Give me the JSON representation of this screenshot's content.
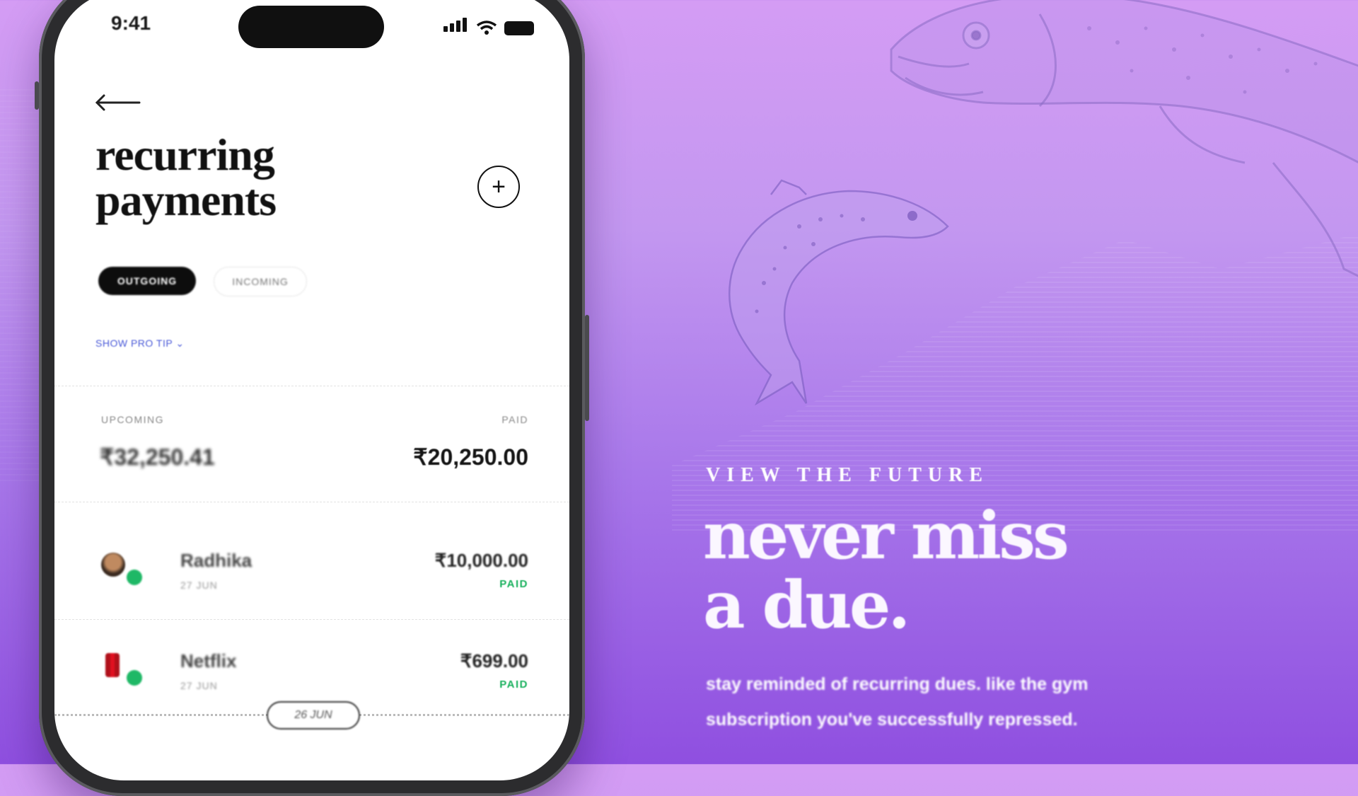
{
  "status_bar": {
    "time": "9:41"
  },
  "screen": {
    "title_line1": "recurring",
    "title_line2": "payments",
    "tabs": [
      {
        "label": "OUTGOING",
        "active": true
      },
      {
        "label": "INCOMING",
        "active": false
      }
    ],
    "pro_tip_link": "SHOW PRO TIP",
    "summary": {
      "upcoming_label": "UPCOMING",
      "upcoming_amount": "₹32,250.41",
      "paid_label": "PAID",
      "paid_amount": "₹20,250.00"
    },
    "payments": [
      {
        "name": "Radhika",
        "date": "27 JUN",
        "amount": "₹10,000.00",
        "status": "PAID"
      },
      {
        "name": "Netflix",
        "date": "27 JUN",
        "amount": "₹699.00",
        "status": "PAID"
      }
    ],
    "timeline_date": "26 JUN"
  },
  "marketing": {
    "eyebrow": "VIEW THE FUTURE",
    "headline_line1": "never miss",
    "headline_line2": "a due.",
    "body_line1": "stay reminded of recurring dues. like the gym",
    "body_line2": "subscription you've successfully repressed."
  },
  "icons": [
    "back-arrow-icon",
    "plus-icon",
    "chevron-down-icon",
    "signal-icon",
    "wifi-icon",
    "battery-icon",
    "check-icon",
    "netflix-logo-icon",
    "fish-illustration"
  ],
  "colors": {
    "bg_top": "#d49cf4",
    "bg_bottom": "#8f4fe0",
    "paid_green": "#17b05c",
    "link_blue": "#4a5ad8"
  }
}
